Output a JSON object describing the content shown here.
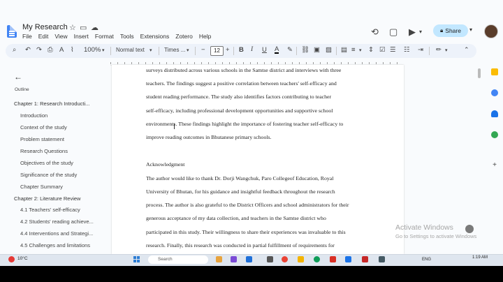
{
  "app": {
    "doc_title": "My Research",
    "menu": [
      "File",
      "Edit",
      "View",
      "Insert",
      "Format",
      "Tools",
      "Extensions",
      "Zotero",
      "Help"
    ],
    "share_label": "Share"
  },
  "toolbar": {
    "zoom": "100%",
    "style": "Normal text",
    "font": "Times ...",
    "font_size": "12",
    "minus": "−",
    "plus": "+"
  },
  "outline": {
    "label": "Outline",
    "items": [
      {
        "text": "Chapter 1: Research Introducti...",
        "level": "chapter"
      },
      {
        "text": "Introduction",
        "level": "sub"
      },
      {
        "text": "Context of the study",
        "level": "sub"
      },
      {
        "text": "Problem statement",
        "level": "sub"
      },
      {
        "text": "Research Questions",
        "level": "sub"
      },
      {
        "text": "Objectives of the study",
        "level": "sub"
      },
      {
        "text": "Significance of the study",
        "level": "sub"
      },
      {
        "text": "Chapter Summary",
        "level": "sub"
      },
      {
        "text": "Chapter 2: Literature Review",
        "level": "chapter"
      },
      {
        "text": "4.1 Teachers' self-efficacy",
        "level": "sub"
      },
      {
        "text": "4.2 Students' reading achieve...",
        "level": "sub"
      },
      {
        "text": "4.4 Interventions and Strategi...",
        "level": "sub"
      },
      {
        "text": "4.5 Challenges and limitations",
        "level": "sub"
      }
    ]
  },
  "document": {
    "lines": [
      "surveys distributed across various schools in the Samtse district and interviews with three",
      "teachers. The findings suggest a positive correlation between teachers' self-efficacy and",
      "student reading performance. The study also identifies factors contributing to teacher",
      "self-efficacy, including professional development opportunities and supportive school",
      "environments. These findings highlight the importance of fostering teacher self-efficacy to",
      "improve reading outcomes in Bhutanese primary schools.",
      "",
      "Acknowledgment",
      "The author would like to thank Dr. Dorji Wangchuk, Paro Collegeof Education, Royal",
      "University of Bhutan, for his guidance and insightful feedback throughout the research",
      "process. The author is also grateful to the District Officers and school administrators for their",
      "generous acceptance of my data collection,  and teachers in the Samtse district who",
      "participated in this study. Their willingness to share their experiences was invaluable to this",
      "research. Finally, this research was conducted in partial fulfillment of requirements for"
    ]
  },
  "watermark": {
    "line1": "Activate Windows",
    "line2": "Go to Settings to activate Windows"
  },
  "taskbar": {
    "temperature": "10°C",
    "search_placeholder": "Search",
    "lang": "ENG",
    "time": "1:19 AM"
  }
}
